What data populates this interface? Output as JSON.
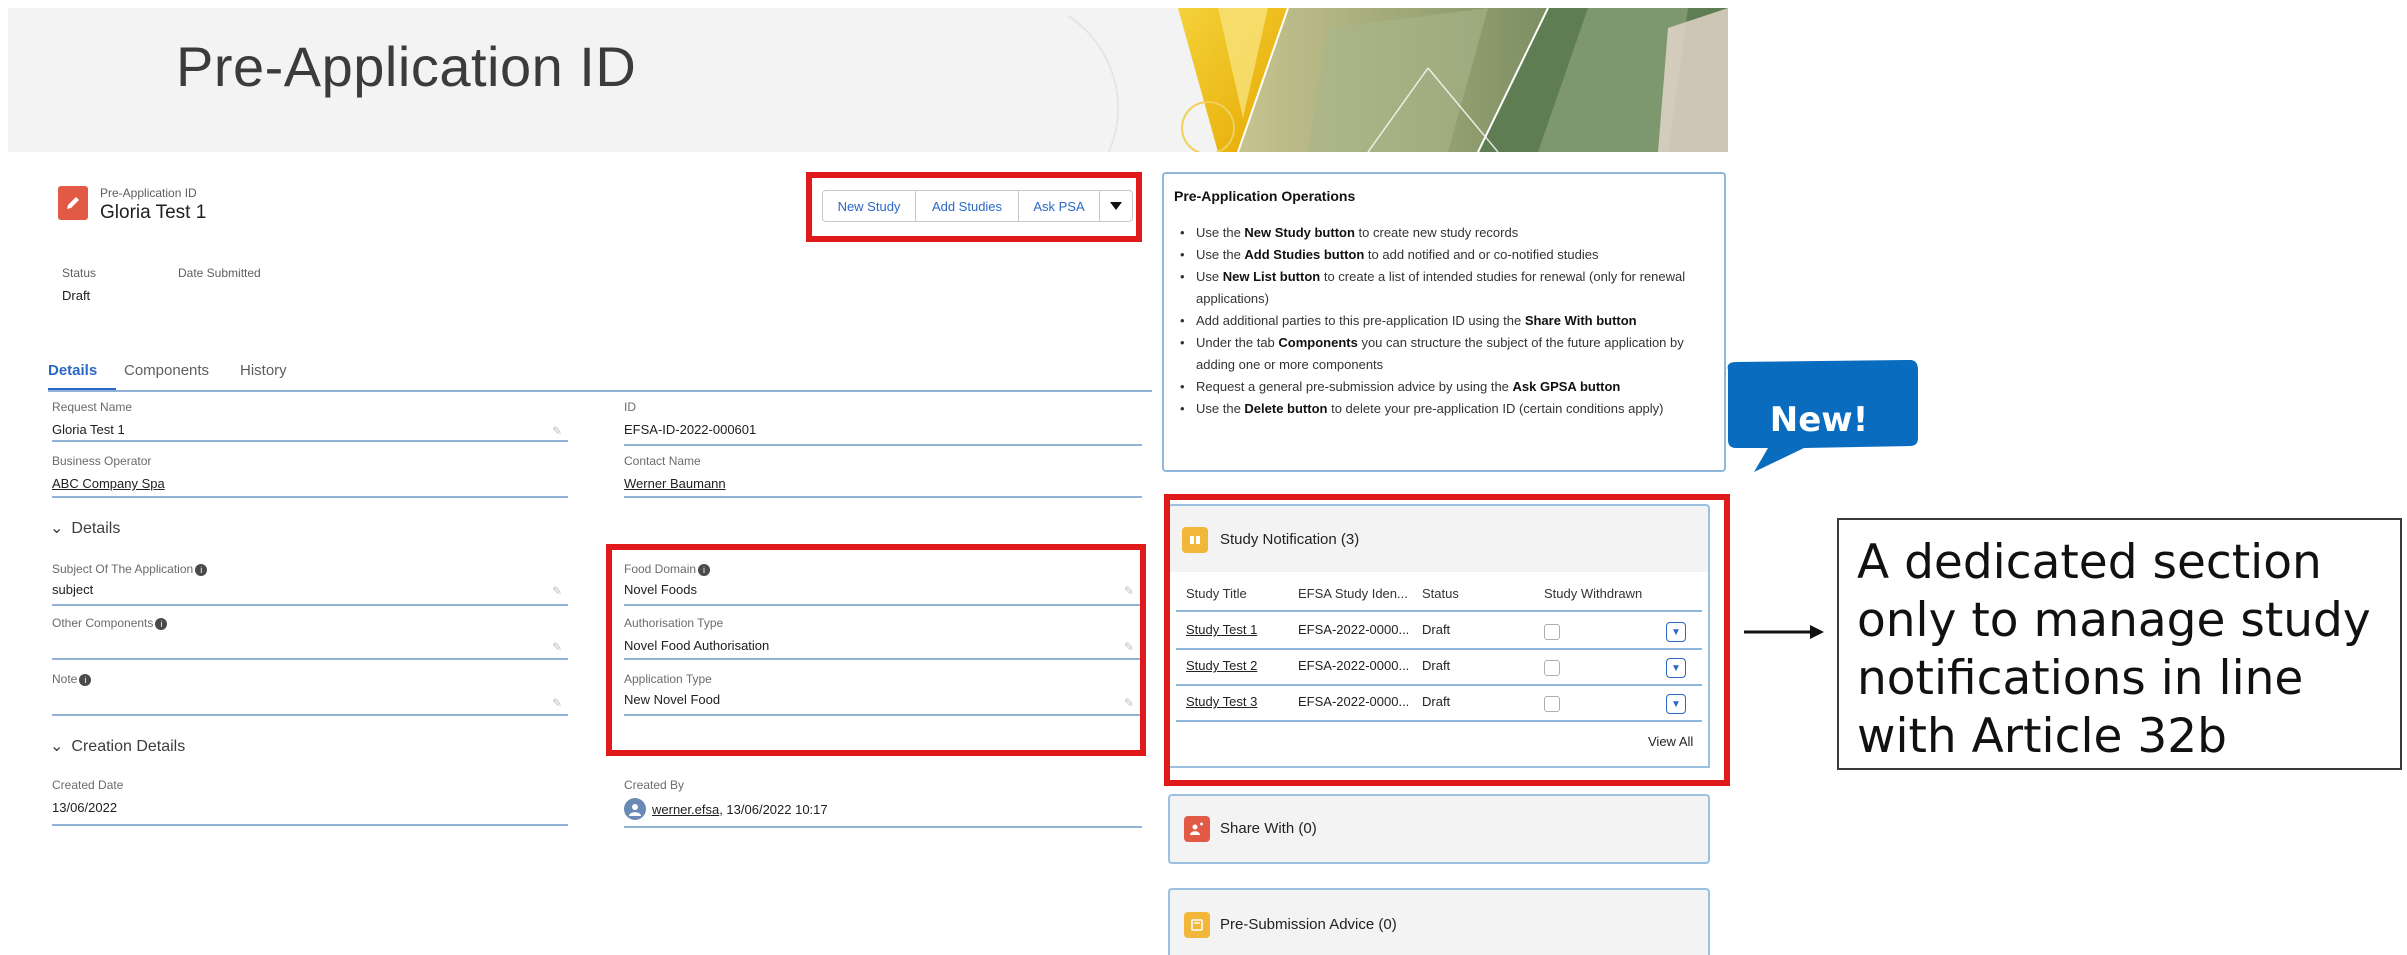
{
  "banner": {
    "title": "Pre-Application ID"
  },
  "record": {
    "object_label": "Pre-Application ID",
    "name": "Gloria Test 1",
    "status_label": "Status",
    "status_value": "Draft",
    "date_submitted_label": "Date Submitted"
  },
  "actions": {
    "new_study": "New Study",
    "add_studies": "Add Studies",
    "ask_psa": "Ask PSA"
  },
  "tabs": [
    "Details",
    "Components",
    "History"
  ],
  "fields": {
    "request_name": {
      "label": "Request Name",
      "value": "Gloria Test 1"
    },
    "id": {
      "label": "ID",
      "value": "EFSA-ID-2022-000601"
    },
    "business_operator": {
      "label": "Business Operator",
      "value": "ABC Company Spa"
    },
    "contact_name": {
      "label": "Contact Name",
      "value": "Werner Baumann"
    },
    "details_section": "Details",
    "subject": {
      "label": "Subject Of The Application",
      "value": "subject"
    },
    "food_domain": {
      "label": "Food Domain",
      "value": "Novel Foods"
    },
    "other_components": {
      "label": "Other Components",
      "value": ""
    },
    "authorisation_type": {
      "label": "Authorisation Type",
      "value": "Novel Food Authorisation"
    },
    "note": {
      "label": "Note",
      "value": ""
    },
    "application_type": {
      "label": "Application Type",
      "value": "New Novel Food"
    },
    "creation_section": "Creation Details",
    "created_date": {
      "label": "Created Date",
      "value": "13/06/2022"
    },
    "created_by": {
      "label": "Created By",
      "user": "werner.efsa",
      "date": ", 13/06/2022 10:17"
    }
  },
  "operations": {
    "title": "Pre-Application Operations",
    "items": [
      {
        "pre": "Use the ",
        "bold": "New Study button",
        "post": " to create new study records"
      },
      {
        "pre": "Use the ",
        "bold": "Add Studies button",
        "post": " to add notified and or co-notified studies"
      },
      {
        "pre": "Use ",
        "bold": "New List button",
        "post": " to create a list of intended studies for renewal (only for renewal applications)"
      },
      {
        "pre": "Add additional parties to this pre-application ID using the ",
        "bold": "Share With button",
        "post": ""
      },
      {
        "pre": "Under the tab ",
        "bold": "Components",
        "post": " you can structure the subject of the future application by adding one or more components"
      },
      {
        "pre": "Request a general pre-submission advice by using the ",
        "bold": "Ask GPSA button",
        "post": ""
      },
      {
        "pre": "Use the ",
        "bold": "Delete button",
        "post": " to delete your pre-application ID (certain conditions apply)"
      }
    ]
  },
  "study_notification": {
    "title": "Study Notification (3)",
    "columns": [
      "Study Title",
      "EFSA Study Iden...",
      "Status",
      "Study Withdrawn"
    ],
    "rows": [
      {
        "title": "Study Test 1",
        "efsa_id": "EFSA-2022-0000...",
        "status": "Draft",
        "withdrawn": false
      },
      {
        "title": "Study Test 2",
        "efsa_id": "EFSA-2022-0000...",
        "status": "Draft",
        "withdrawn": false
      },
      {
        "title": "Study Test 3",
        "efsa_id": "EFSA-2022-0000...",
        "status": "Draft",
        "withdrawn": false
      }
    ],
    "view_all": "View All"
  },
  "share_with": {
    "title": "Share With (0)"
  },
  "pre_submission_advice": {
    "title": "Pre-Submission Advice (0)"
  },
  "annotations": {
    "new_badge": "New!",
    "callout": "A dedicated section only to manage study notifications in line with Article 32b"
  },
  "colors": {
    "highlight": "#e01a1a",
    "accent_blue": "#2b67c6",
    "bubble_blue": "#0a6cbf",
    "field_underline": "#8fb2d6"
  }
}
